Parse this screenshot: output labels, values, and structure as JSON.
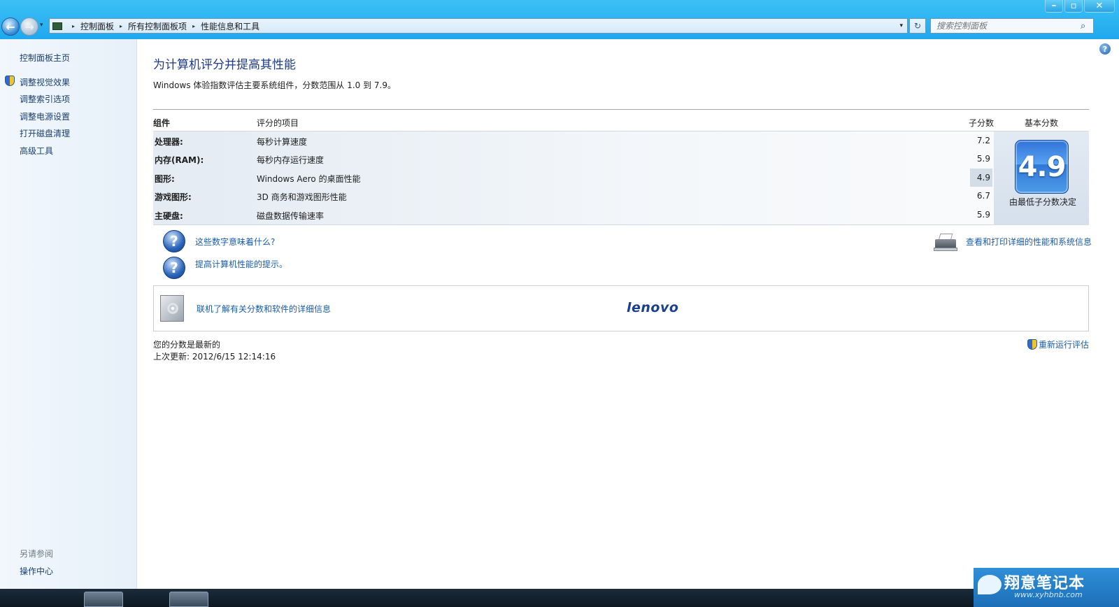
{
  "window": {
    "controls": {
      "minimize": "–",
      "maximize": "▫",
      "close": "✕"
    }
  },
  "nav": {
    "back": "←",
    "forward": "→",
    "dropdown": "▾"
  },
  "address": {
    "crumbs": [
      "控制面板",
      "所有控制面板项",
      "性能信息和工具"
    ],
    "sep": "▸",
    "dropdown": "▾",
    "refresh": "↻"
  },
  "search": {
    "placeholder": "搜索控制面板",
    "icon": "⌕"
  },
  "sidebar": {
    "home": "控制面板主页",
    "items": [
      "调整视觉效果",
      "调整索引选项",
      "调整电源设置",
      "打开磁盘清理",
      "高级工具"
    ],
    "see_also_label": "另请参阅",
    "see_also_items": [
      "操作中心"
    ]
  },
  "main": {
    "help": "?",
    "title": "为计算机评分并提高其性能",
    "subtitle": "Windows 体验指数评估主要系统组件，分数范围从 1.0 到 7.9。",
    "table": {
      "headers": {
        "component": "组件",
        "item": "评分的项目",
        "subscore": "子分数",
        "base": "基本分数"
      },
      "rows": [
        {
          "component": "处理器:",
          "item": "每秒计算速度",
          "subscore": "7.2"
        },
        {
          "component": "内存(RAM):",
          "item": "每秒内存运行速度",
          "subscore": "5.9"
        },
        {
          "component": "图形:",
          "item": "Windows Aero 的桌面性能",
          "subscore": "4.9"
        },
        {
          "component": "游戏图形:",
          "item": "3D 商务和游戏图形性能",
          "subscore": "6.7"
        },
        {
          "component": "主硬盘:",
          "item": "磁盘数据传输速率",
          "subscore": "5.9"
        }
      ],
      "base_score": "4.9",
      "base_caption": "由最低子分数决定"
    },
    "links": {
      "what_numbers_mean": "这些数字意味着什么?",
      "tips": "提高计算机性能的提示。",
      "print_details": "查看和打印详细的性能和系统信息",
      "online_info": "联机了解有关分数和软件的详细信息"
    },
    "question_glyph": "?",
    "oem_logo": "lenovo",
    "status": {
      "current": "您的分数是最新的",
      "last_update_label": "上次更新: ",
      "last_update_value": "2012/6/15 12:14:16"
    },
    "rerun": "重新运行评估"
  },
  "watermark": {
    "main": "翔意笔记本",
    "sub": "www.xyhbnb.com"
  },
  "colors": {
    "accent": "#1ea8ee",
    "link": "#1b5ca8",
    "title": "#1f3b87",
    "badge": "#2f73d7"
  }
}
